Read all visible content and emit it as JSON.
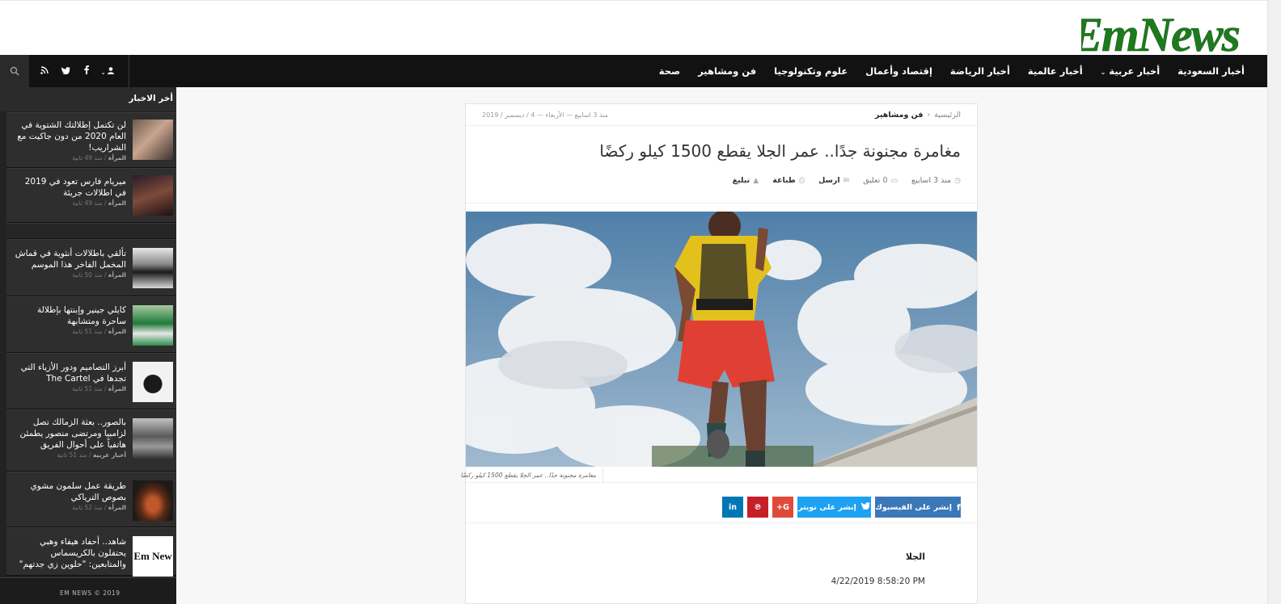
{
  "brand": {
    "logo_text": "EmNews",
    "logo_color": "#1e7a1e"
  },
  "nav": {
    "items": [
      "أخبار السعودية",
      "أخبار عربية",
      "أخبار عالمية",
      "أخبار الرياضة",
      "إقتصاد وأعمال",
      "علوم وتكنولوجيا",
      "فن ومشاهير",
      "صحة"
    ],
    "icons": [
      "search-icon",
      "user-icon",
      "facebook-icon",
      "twitter-icon",
      "rss-icon"
    ]
  },
  "sidebar": {
    "header": "أخر الاخبار",
    "items": [
      {
        "title": "لن تكتمل إطلالتك الشتوية في العام 2020 من دون جاكيت مع الشراريب!",
        "category": "المرأة",
        "time": "منذ 49 ثانية"
      },
      {
        "title": "ميريام فارس تعود في 2019 في اطلالات جريئة",
        "category": "المرأة",
        "time": "منذ 49 ثانية"
      },
      {
        "title": "تألقي باطلالات أنثوية في قماش المخمل الفاخر هذا الموسم",
        "category": "المرأة",
        "time": "منذ 50 ثانية"
      },
      {
        "title": "كايلي جينير وإبنتها بإطلالة ساحرة ومتشابهة",
        "category": "المرأة",
        "time": "منذ 51 ثانية"
      },
      {
        "title": "أبرز التصاميم ودور الأزياء التي تجدها في The Cartel",
        "category": "المرأة",
        "time": "منذ 51 ثانية"
      },
      {
        "title": "بالصور.. بعثة الزمالك تصل لزامبيا ومرتضى منصور يطمئن هاتفياً على أحوال الفريق",
        "category": "أخبار عربية",
        "time": "منذ 51 ثانية"
      },
      {
        "title": "طريقة عمل سلمون مشوي بصوص الترياكي",
        "category": "المرأة",
        "time": "منذ 52 ثانية"
      },
      {
        "title": "شاهد.. أحفاد هيفاء وهبي يحتفلون بالكريسماس والمتابعين: \"حلوين زي جدتهم\"",
        "category": "",
        "time": ""
      }
    ],
    "thumb_8_text": "Em New",
    "footer": "EM NEWS © 2019"
  },
  "article": {
    "breadcrumb_home": "الرئيسية",
    "breadcrumb_current": "فن ومشاهير",
    "date_line": "منذ 3 اسابيع — الأربعاء — 4 / ديسمبر / 2019",
    "title": "مغامرة مجنونة جدًا.. عمر الجلا يقطع 1500 كيلو ركضًا",
    "meta_time": "منذ 3 اسابيع",
    "meta_comments": "0 تعليق",
    "meta_send": "ارسل",
    "meta_print": "طباعة",
    "meta_report": "تبليغ",
    "caption": "مغامرة مجنونة جدًا.. عمر الجلا يقطع 1500 كيلو ركضًا",
    "share_facebook": "إنشر على الفيسبوك",
    "share_twitter": "إنشر على تويتر",
    "body_tag": "الجلا",
    "body_date": "4/22/2019 8:58:20 PM"
  }
}
